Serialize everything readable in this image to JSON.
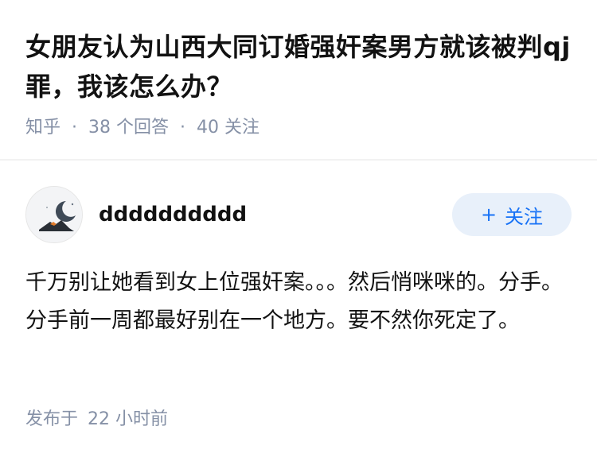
{
  "question": {
    "title": "女朋友认为山西大同订婚强奸案男方就该被判qj罪，我该怎么办？",
    "source": "知乎",
    "dot": "·",
    "answers_count": "38 个回答",
    "followers_count": "40 关注"
  },
  "answer": {
    "author_name": "dddddddddd",
    "avatar_icon": "night-moon-avatar",
    "follow_button": {
      "plus": "+",
      "label": "关注"
    },
    "content": "千万别让她看到女上位强奸案。。。然后悄咪咪的。分手。分手前一周都最好别在一个地方。要不然你死定了。",
    "published_label": "发布于",
    "published_time": "22 小时前"
  },
  "colors": {
    "primary_text": "#121212",
    "meta_text": "#8590a6",
    "accent": "#1772f6",
    "follow_bg": "#e8f0fa"
  }
}
